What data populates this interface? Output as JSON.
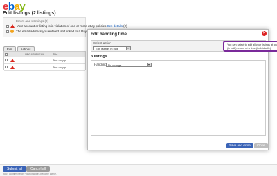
{
  "header": {
    "logo_letters": [
      {
        "char": "e",
        "color": "#e53238"
      },
      {
        "char": "b",
        "color": "#0064d2"
      },
      {
        "char": "a",
        "color": "#f5af02"
      },
      {
        "char": "y",
        "color": "#86b817"
      }
    ],
    "title_prefix": "Edit listings (",
    "count": "2",
    "title_suffix": " listings)"
  },
  "alerts": {
    "header": "Errors and warnings (2)",
    "items": [
      {
        "text": "Your account or listing is in violation of one or more eBay policies ",
        "link": "See details",
        "suffix": " (2)",
        "icon": "warning-icon"
      },
      {
        "text": "The email address you entered isn't linked to a PayPal ac",
        "link": "",
        "suffix": "",
        "icon": "info-icon"
      }
    ]
  },
  "toolbar": {
    "edit_label": "Edit",
    "actions_label": "Actions"
  },
  "grid": {
    "columns": [
      "UPC/ISBN/EAN",
      "Title"
    ],
    "rows": [
      {
        "title": "Test only pl"
      },
      {
        "title": "Test only pl"
      }
    ]
  },
  "bottom": {
    "submit_label": "Submit all",
    "cancel_label": "Cancel all",
    "footnote": "You'll confirm before your changes become active."
  },
  "modal": {
    "title": "Edit handling time",
    "close_icon": "×",
    "select_action_label": "Select action",
    "select_action_value": "Edit listings in bulk",
    "tooltip_text": "You can select to edit all your listings at once (in bulk) or one at a time (individually).",
    "tooltip_close": "×",
    "listings_heading": "3 listings",
    "handling_label": "Handling time",
    "handling_value": "No change",
    "save_label": "Save and close",
    "close_label": "Close"
  },
  "colors": {
    "primary_button": "#3b64b7",
    "tooltip_border": "#7a2a9a",
    "error": "#d9261c"
  }
}
